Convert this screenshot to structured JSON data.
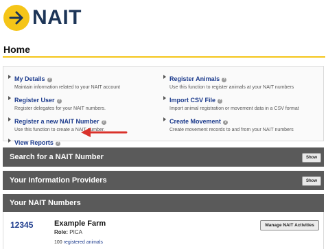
{
  "header": {
    "logo_text": "NAIT",
    "logo_icon": "arrow-right-circle-icon",
    "accent_color": "#f5c518",
    "brand_color": "#1d3557"
  },
  "page": {
    "title": "Home"
  },
  "quick_links": {
    "left": [
      {
        "label": "My Details",
        "desc": "Maintain information related to your NAIT account"
      },
      {
        "label": "Register User",
        "desc": "Register delegates for your NAIT numbers."
      },
      {
        "label": "Register a new NAIT Number",
        "desc": "Use this function to create a NAIT number."
      },
      {
        "label": "View Reports",
        "desc": ""
      }
    ],
    "right": [
      {
        "label": "Register Animals",
        "desc": "Use this function to register animals at your NAIT numbers"
      },
      {
        "label": "Import CSV File",
        "desc": "Import animal registration or movement data in a CSV format"
      },
      {
        "label": "Create Movement",
        "desc": "Create movement records to and from your NAIT numbers"
      }
    ],
    "help_glyph": "?"
  },
  "sections": {
    "search": {
      "title": "Search for a NAIT Number",
      "button": "Show"
    },
    "providers": {
      "title": "Your Information Providers",
      "button": "Show"
    },
    "numbers": {
      "title": "Your NAIT Numbers"
    }
  },
  "farm": {
    "number": "12345",
    "name": "Example Farm",
    "role_label": "Role:",
    "role_value": "PICA",
    "animal_count": "100",
    "animals_link": "registered animals",
    "manage_button": "Manage NAIT Activities"
  },
  "annotation": {
    "arrow_color": "#d9322b"
  }
}
